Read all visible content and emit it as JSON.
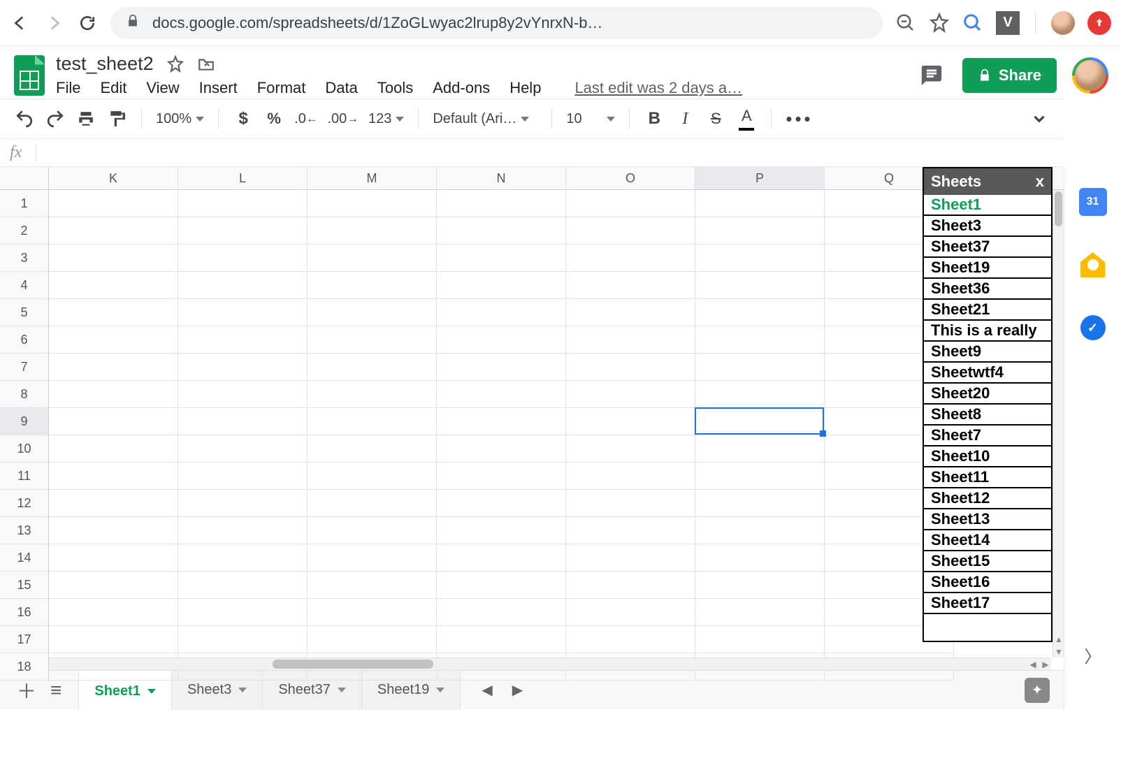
{
  "browser": {
    "url": "docs.google.com/spreadsheets/d/1ZoGLwyac2lrup8y2vYnrxN-b…",
    "ext_letter": "V"
  },
  "doc": {
    "title": "test_sheet2",
    "menus": [
      "File",
      "Edit",
      "View",
      "Insert",
      "Format",
      "Data",
      "Tools",
      "Add-ons",
      "Help"
    ],
    "last_edit": "Last edit was 2 days a…",
    "share_label": "Share"
  },
  "toolbar": {
    "zoom": "100%",
    "number_format_more": "123",
    "font": "Default (Ari…",
    "font_size": "10"
  },
  "sidepanel": {
    "calendar_day": "31"
  },
  "grid": {
    "formula": "",
    "columns": [
      "K",
      "L",
      "M",
      "N",
      "O",
      "P",
      "Q"
    ],
    "rows": [
      1,
      2,
      3,
      4,
      5,
      6,
      7,
      8,
      9,
      10,
      11,
      12,
      13,
      14,
      15,
      16,
      17,
      18
    ],
    "selected_column": "P",
    "selected_row": 9
  },
  "sheets_panel": {
    "title": "Sheets",
    "close": "x",
    "items": [
      "Sheet1",
      "Sheet3",
      "Sheet37",
      "Sheet19",
      "Sheet36",
      "Sheet21",
      "This is a really",
      "Sheet9",
      "Sheetwtf4",
      "Sheet20",
      "Sheet8",
      "Sheet7",
      "Sheet10",
      "Sheet11",
      "Sheet12",
      "Sheet13",
      "Sheet14",
      "Sheet15",
      "Sheet16",
      "Sheet17"
    ],
    "active_index": 0
  },
  "tabs": {
    "items": [
      "Sheet1",
      "Sheet3",
      "Sheet37",
      "Sheet19"
    ],
    "active_index": 0
  }
}
